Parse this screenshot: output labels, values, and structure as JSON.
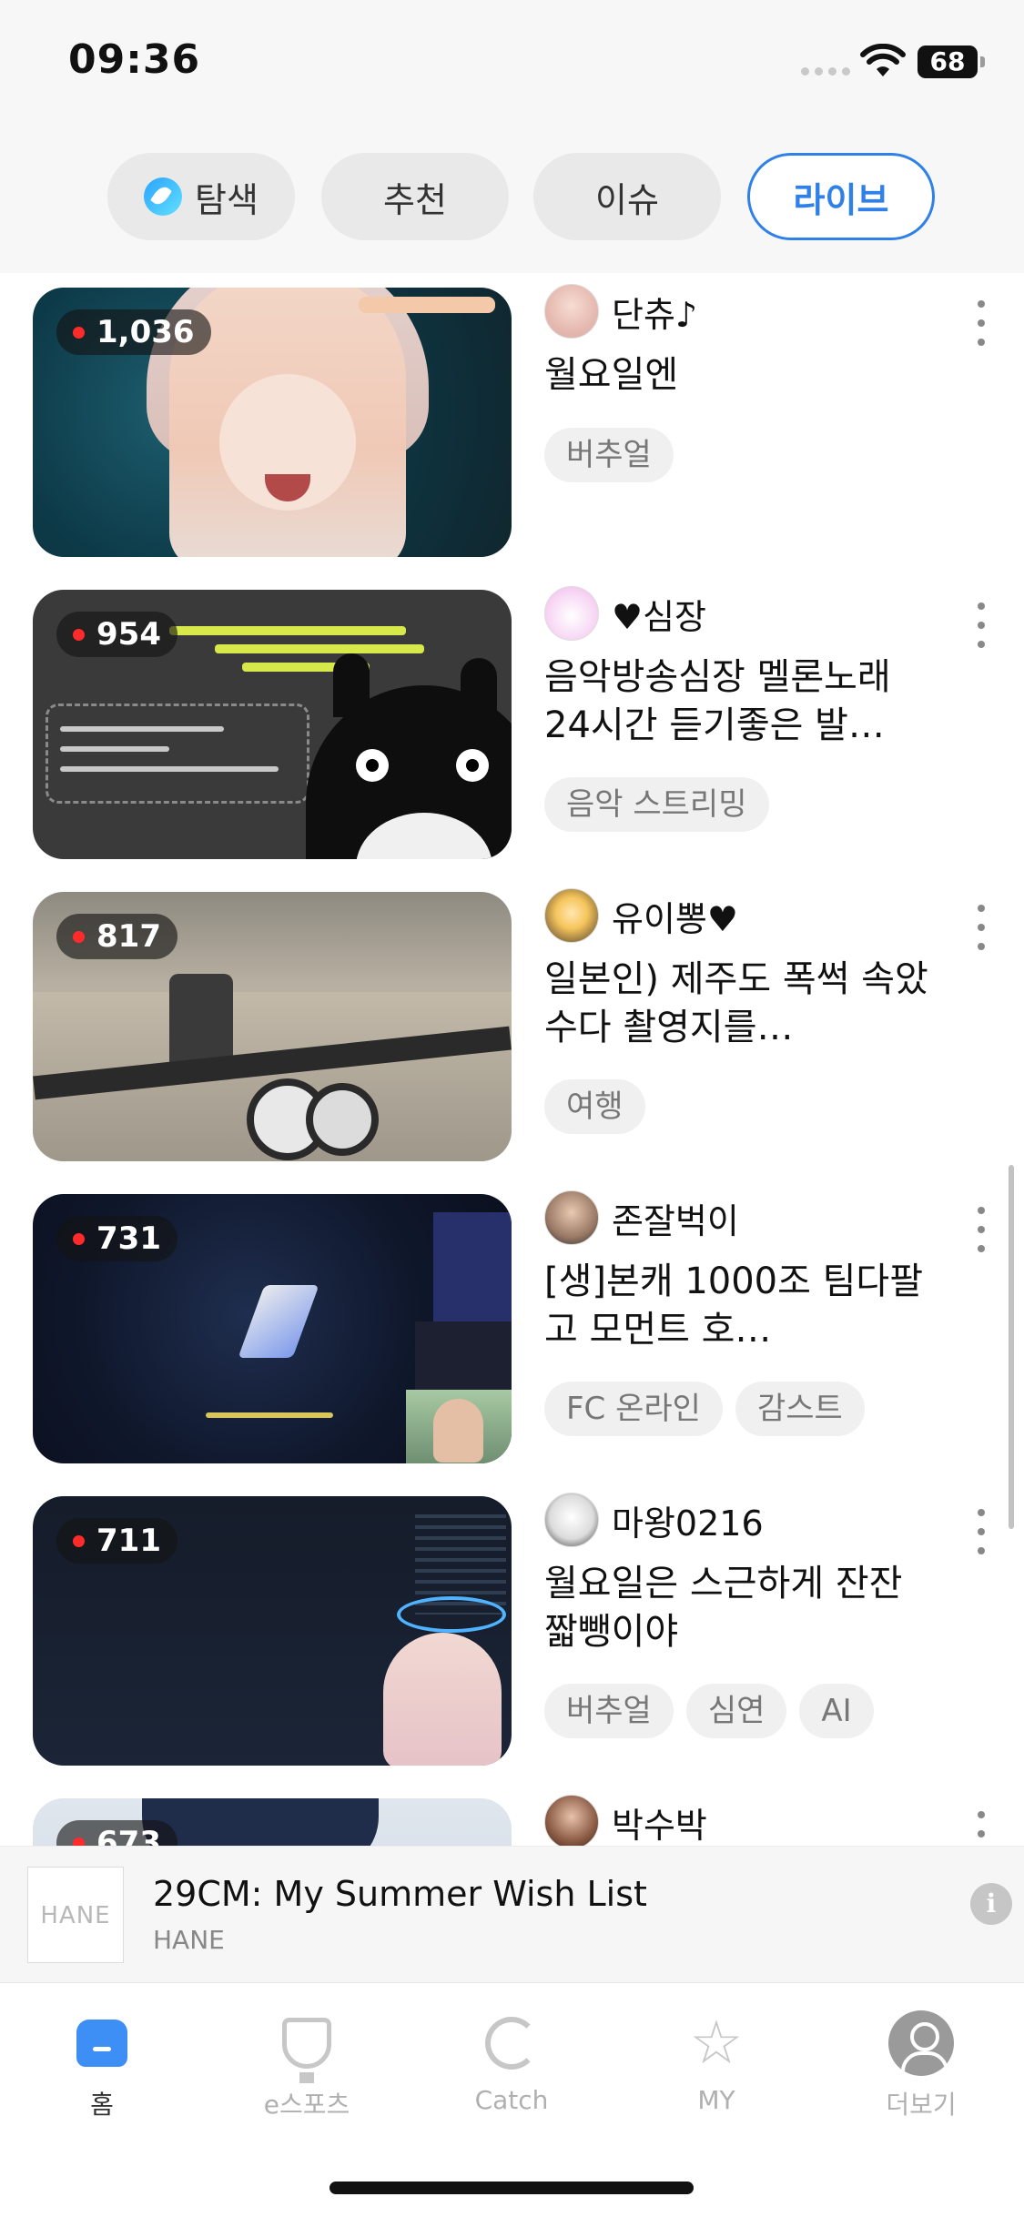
{
  "status_bar": {
    "time": "09:36",
    "battery": "68"
  },
  "tabs": [
    {
      "label": "탐색",
      "icon": "compass-icon",
      "active": false
    },
    {
      "label": "추천",
      "active": false
    },
    {
      "label": "이슈",
      "active": false
    },
    {
      "label": "라이브",
      "active": true
    }
  ],
  "streams": [
    {
      "viewers": "1,036",
      "streamer": "단츄♪",
      "title": "월요일엔",
      "tags": [
        "버추얼"
      ]
    },
    {
      "viewers": "954",
      "streamer": "♥심장",
      "title": "음악방송심장 멜론노래 24시간 듣기좋은 발…",
      "tags": [
        "음악 스트리밍"
      ]
    },
    {
      "viewers": "817",
      "streamer": "유이뽕♥",
      "title": "일본인) 제주도 폭썩 속았수다 촬영지를…",
      "tags": [
        "여행"
      ]
    },
    {
      "viewers": "731",
      "streamer": "존잘벅이",
      "title": "[생]본캐 1000조 팀다팔고 모먼트 호…",
      "tags": [
        "FC 온라인",
        "감스트"
      ]
    },
    {
      "viewers": "711",
      "streamer": "마왕0216",
      "title": "월요일은 스근하게 잔잔짧뺑이야",
      "tags": [
        "버추얼",
        "심연",
        "AI"
      ]
    },
    {
      "viewers": "673",
      "streamer": "박수박",
      "title": "",
      "tags": []
    }
  ],
  "ad": {
    "logo_text": "HANE",
    "title": "29CM: My Summer Wish List",
    "advertiser": "HANE",
    "info_icon": "i"
  },
  "bottom_nav": [
    {
      "label": "홈",
      "icon": "home-icon",
      "active": true
    },
    {
      "label": "e스포츠",
      "icon": "trophy-icon",
      "active": false
    },
    {
      "label": "Catch",
      "icon": "catch-icon",
      "active": false
    },
    {
      "label": "MY",
      "icon": "star-icon",
      "active": false
    },
    {
      "label": "더보기",
      "icon": "profile-icon",
      "active": false
    }
  ],
  "colors": {
    "accent": "#2f80e8",
    "live_dot": "#ff2b2b",
    "home_icon": "#3d8ef5"
  }
}
